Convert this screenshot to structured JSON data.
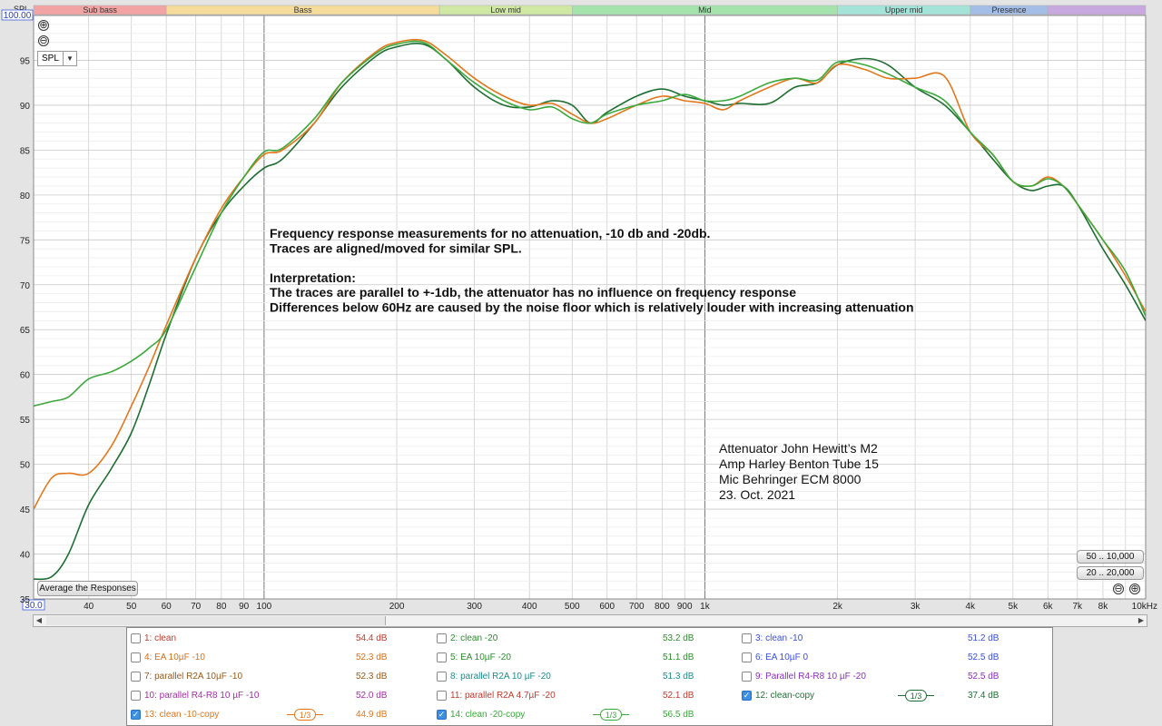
{
  "chart_data": {
    "type": "line",
    "xscale": "log",
    "xlim": [
      30,
      10000
    ],
    "ylim": [
      35,
      100
    ],
    "ylabel": "SPL",
    "x_ticks": [
      40,
      50,
      60,
      70,
      80,
      90,
      100,
      200,
      300,
      400,
      500,
      600,
      700,
      800,
      900,
      1000,
      2000,
      3000,
      4000,
      5000,
      6000,
      7000,
      8000,
      10000
    ],
    "x_tick_labels": [
      "40",
      "50",
      "60",
      "70",
      "80",
      "90",
      "100",
      "200",
      "300",
      "400",
      "500",
      "600",
      "700",
      "800",
      "900",
      "1k",
      "2k",
      "3k",
      "4k",
      "5k",
      "6k",
      "7k",
      "8k",
      "10kHz"
    ],
    "x_min_label": "30.0",
    "y_ticks": [
      40,
      45,
      50,
      55,
      60,
      65,
      70,
      75,
      80,
      85,
      90,
      95
    ],
    "y_max_label": "100.00",
    "bands": [
      {
        "name": "Sub bass",
        "from": 30,
        "to": 60,
        "color": "#f2a3a3"
      },
      {
        "name": "Bass",
        "from": 60,
        "to": 250,
        "color": "#f5dc9a"
      },
      {
        "name": "Low mid",
        "from": 250,
        "to": 500,
        "color": "#cfe8a3"
      },
      {
        "name": "Mid",
        "from": 500,
        "to": 2000,
        "color": "#a5e3ad"
      },
      {
        "name": "Upper mid",
        "from": 2000,
        "to": 4000,
        "color": "#a3e3d8"
      },
      {
        "name": "Presence",
        "from": 4000,
        "to": 6000,
        "color": "#a3bde6"
      },
      {
        "name": "",
        "from": 6000,
        "to": 10000,
        "color": "#c7a8df"
      }
    ],
    "series": [
      {
        "name": "12: clean-copy",
        "color": "#1e6e32",
        "x": [
          30,
          33,
          36,
          40,
          45,
          50,
          55,
          60,
          70,
          80,
          90,
          100,
          110,
          130,
          150,
          180,
          200,
          230,
          260,
          300,
          350,
          400,
          450,
          500,
          550,
          600,
          700,
          800,
          900,
          1000,
          1100,
          1200,
          1400,
          1600,
          1800,
          2000,
          2300,
          2600,
          3000,
          3500,
          4000,
          4500,
          5000,
          5500,
          6000,
          6500,
          7000,
          8000,
          9000,
          10000
        ],
        "y": [
          37.2,
          37.5,
          40,
          45.5,
          49.5,
          53.5,
          59,
          64.5,
          73,
          78,
          81,
          83,
          84,
          88,
          92,
          95.5,
          96.5,
          96.8,
          95,
          92,
          90,
          89.8,
          90.5,
          90,
          88,
          89.2,
          91,
          91.8,
          91,
          90.5,
          90,
          90.2,
          90.2,
          92,
          92.5,
          94.5,
          95.2,
          94.5,
          92,
          90,
          87,
          84,
          81.5,
          80.5,
          81,
          81,
          79,
          74,
          70,
          66
        ]
      },
      {
        "name": "13: clean -10-copy",
        "color": "#e2761b",
        "x": [
          30,
          33,
          36,
          40,
          45,
          50,
          55,
          60,
          70,
          80,
          90,
          100,
          110,
          130,
          150,
          180,
          200,
          230,
          260,
          300,
          350,
          400,
          450,
          500,
          550,
          600,
          700,
          800,
          900,
          1000,
          1100,
          1200,
          1400,
          1600,
          1800,
          2000,
          2300,
          2600,
          3000,
          3500,
          4000,
          4500,
          5000,
          5500,
          6000,
          6500,
          7000,
          8000,
          9000,
          10000
        ],
        "y": [
          45,
          48.5,
          49,
          49,
          52,
          56.5,
          61,
          65.5,
          73,
          78.5,
          82,
          84.5,
          85,
          88,
          92.5,
          96,
          97,
          97.2,
          95.5,
          93,
          91,
          90,
          90.2,
          89,
          88,
          88.5,
          90,
          91,
          90.5,
          90.2,
          89.5,
          90.5,
          92,
          93,
          92.5,
          94.5,
          94,
          93,
          93,
          93.2,
          87,
          84.5,
          81.5,
          81,
          82,
          81,
          79,
          75,
          71,
          67
        ]
      },
      {
        "name": "14: clean -20-copy",
        "color": "#3aa83a",
        "x": [
          30,
          33,
          36,
          40,
          45,
          50,
          55,
          60,
          70,
          80,
          90,
          100,
          110,
          130,
          150,
          180,
          200,
          230,
          260,
          300,
          350,
          400,
          450,
          500,
          550,
          600,
          700,
          800,
          900,
          1000,
          1100,
          1200,
          1400,
          1600,
          1800,
          2000,
          2300,
          2600,
          3000,
          3500,
          4000,
          4500,
          5000,
          5500,
          6000,
          6500,
          7000,
          8000,
          9000,
          10000
        ],
        "y": [
          56.5,
          57,
          57.5,
          59.5,
          60.3,
          61.5,
          63,
          65,
          72,
          78,
          82,
          84.8,
          85.2,
          88.5,
          92.5,
          95.8,
          96.8,
          97,
          95,
          92.5,
          90.5,
          89.5,
          89.8,
          88.5,
          88,
          89,
          90,
          90.5,
          91.2,
          90.5,
          90.5,
          91,
          92.5,
          93,
          92.8,
          94.8,
          94.5,
          93.5,
          92,
          90.5,
          87,
          84.5,
          81.5,
          81,
          81.8,
          81,
          79,
          75,
          71.5,
          66.5
        ]
      }
    ],
    "annotation_main": [
      "Frequency response measurements for no attenuation, -10 db and -20db.",
      "Traces are aligned/moved for similar SPL.",
      "",
      "Interpretation:",
      "The traces are parallel to +-1db, the attenuator has no influence on frequency response",
      "Differences below 60Hz are caused by the noise floor which is relatively louder with increasing attenuation"
    ],
    "annotation_info": [
      "Attenuator John Hewitt’s M2",
      "Amp Harley Benton Tube 15",
      "Mic Behringer ECM 8000",
      "23. Oct. 2021"
    ]
  },
  "controls": {
    "spl_select": "SPL",
    "zoom_in": "⊕",
    "zoom_out": "⊖",
    "avg_button": "Average the Responses",
    "range_50_10k": "50 .. 10,000",
    "range_20_20k": "20 .. 20,000",
    "scroll_left": "◀",
    "scroll_right": "▶"
  },
  "legend": [
    {
      "label": "1: clean",
      "value": "54.4 dB",
      "color": "#c0392b",
      "checked": false
    },
    {
      "label": "2: clean -20",
      "value": "53.2 dB",
      "color": "#2e8b2e",
      "checked": false
    },
    {
      "label": "3: clean -10",
      "value": "51.2 dB",
      "color": "#3a4fd6",
      "checked": false
    },
    {
      "label": "4: EA 10µF -10",
      "value": "52.3 dB",
      "color": "#d4701b",
      "checked": false
    },
    {
      "label": "5: EA 10µF -20",
      "value": "51.1 dB",
      "color": "#2e8b2e",
      "checked": false
    },
    {
      "label": "6: EA 10µF 0",
      "value": "52.5 dB",
      "color": "#3a4fd6",
      "checked": false
    },
    {
      "label": "7: parallel R2A 10µF -10",
      "value": "52.3 dB",
      "color": "#9a5a1a",
      "checked": false
    },
    {
      "label": "8: parallel R2A 10 µF -20",
      "value": "51.3 dB",
      "color": "#1f8a8a",
      "checked": false
    },
    {
      "label": "9: Parallel R4-R8 10 µF -20",
      "value": "52.5 dB",
      "color": "#8a2fc0",
      "checked": false
    },
    {
      "label": "10: parallel R4-R8 10 µF -10",
      "value": "52.0 dB",
      "color": "#a12fa1",
      "checked": false
    },
    {
      "label": "11: parallel R2A 4.7µF -20",
      "value": "52.1 dB",
      "color": "#c0392b",
      "checked": false
    },
    {
      "label": "12: clean-copy",
      "value": "37.4 dB",
      "color": "#1e6e32",
      "checked": true,
      "smoothing": "1/3"
    },
    {
      "label": "13: clean -10-copy",
      "value": "44.9 dB",
      "color": "#e2761b",
      "checked": true,
      "smoothing": "1/3"
    },
    {
      "label": "14: clean -20-copy",
      "value": "56.5 dB",
      "color": "#3aa83a",
      "checked": true,
      "smoothing": "1/3"
    }
  ]
}
